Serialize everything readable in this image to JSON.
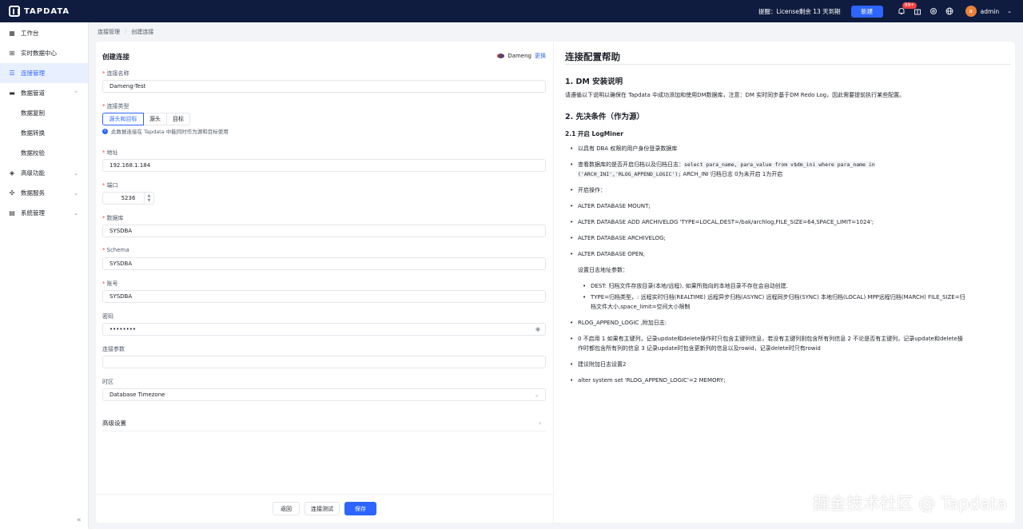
{
  "topbar": {
    "logo": "TAPDATA",
    "notice": "提醒：License剩余 13 天到期",
    "new_label": "新建",
    "bell_badge": "99+",
    "user_initial": "a",
    "user_name": "admin"
  },
  "sidebar": {
    "items": [
      {
        "label": "工作台",
        "icon": "dashboard-icon"
      },
      {
        "label": "实时数据中心",
        "icon": "data-center-icon"
      },
      {
        "label": "连接管理",
        "icon": "connection-icon",
        "active": true
      },
      {
        "label": "数据管道",
        "icon": "pipeline-icon"
      },
      {
        "label": "数据复制"
      },
      {
        "label": "数据转换"
      },
      {
        "label": "数据校验"
      },
      {
        "label": "高级功能",
        "icon": "advanced-icon"
      },
      {
        "label": "数据服务",
        "icon": "service-icon"
      },
      {
        "label": "系统管理",
        "icon": "system-icon"
      }
    ]
  },
  "breadcrumb": [
    "连接管理",
    "创建连接"
  ],
  "form": {
    "title": "创建连接",
    "db_name": "Dameng",
    "change_label": "更换",
    "name_label": "连接名称",
    "name_value": "Dameng-Test",
    "type_label": "连接类型",
    "type_options": [
      "源头和目标",
      "源头",
      "目标"
    ],
    "type_hint": "此数据连接在 Tapdata 中能同时作为源和目标使用",
    "host_label": "地址",
    "host_value": "192.168.1.184",
    "port_label": "端口",
    "port_value": "5236",
    "db_label": "数据库",
    "db_value": "SYSDBA",
    "schema_label": "Schema",
    "schema_value": "SYSDBA",
    "user_label": "账号",
    "user_value": "SYSDBA",
    "password_label": "密码",
    "password_value": "••••••••",
    "params_label": "连接参数",
    "params_value": "",
    "tz_label": "时区",
    "tz_value": "Database Timezone",
    "advanced_label": "高级设置",
    "back_label": "返回",
    "test_label": "连接测试",
    "save_label": "保存"
  },
  "help": {
    "title": "连接配置帮助",
    "s1": "1. DM 安装说明",
    "s1_text": "请遵循以下说明以确保在 Tapdata 中成功添加和使用DM数据库，注意：DM 实时同步基于DM Redo Log，因此需要提前执行某些配置。",
    "s2": "2. 先决条件（作为源）",
    "s21": "2.1 开启 LogMiner",
    "b1": "以具有 DBA 权限的用户身份登录数据库",
    "b2_pre": "查看数据库的是否开启归档以及归档日志：",
    "b2_code1": "select para_name, para_value from v$dm_ini where para_name in",
    "b2_code2": "('ARCH_INI','RLOG_APPEND_LOGIC');",
    "b2_post": " ARCH_INI 归档日志 0为未开启 1为开启",
    "b3": "开启操作：",
    "b4": "ALTER DATABASE MOUNT;",
    "b5": "ALTER DATABASE ADD ARCHIVELOG 'TYPE=LOCAL,DEST=/bak/archlog,FILE_SIZE=64,SPACE_LIMIT=1024';",
    "b6": "ALTER DATABASE ARCHIVELOG;",
    "b7": "ALTER DATABASE OPEN;",
    "params_title": "设置日志地址参数：",
    "sb1": "DEST: 归档文件存放目录(本地/远程), 如果所指向的本地目录不存在会自动创建.",
    "sb2a": "TYPE=归档类型，: 远程实时归档(REALTIME) 远程异步归档(ASYNC) 远程同步归档(SYNC) 本地归档(LOCAL) MPP远程归档(MARCH) FILE_SIZE=归",
    "sb2b": "档文件大小,space_limit=空间大小限制",
    "b8": "RLOG_APPEND_LOGIC ,附加日志:",
    "b9a": "0 不启用 1 如果有主键列，记录update和delete操作时只包含主键列信息，若没有主键列则包含所有列信息 2 不论是否有主键列，记录update和delete操",
    "b9b": "作时都包含所有列的信息 3 记录update时包含更新列的信息以及rowid，记录delete时只有rowid",
    "b10": "建议附加日志设置2",
    "b11": "alter system set 'RLOG_APPEND_LOGIC'=2 MEMORY;"
  },
  "watermark": "掘金技术社区 @ Tapdata"
}
